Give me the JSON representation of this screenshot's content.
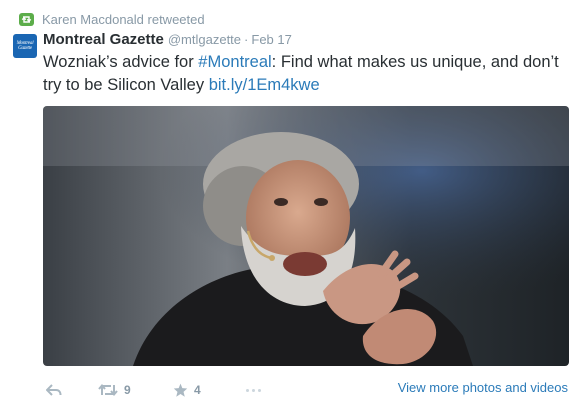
{
  "retweet": {
    "text": "Karen Macdonald retweeted",
    "icon": "retweet-icon",
    "color": "#5cad4a"
  },
  "tweet": {
    "avatar_text": "Montreal Gazette",
    "author": "Montreal Gazette",
    "handle": "@mtlgazette",
    "separator": "·",
    "time": "Feb 17",
    "text_before": "Wozniak’s advice for ",
    "hashtag": "#Montreal",
    "text_after": ": Find what makes us unique, and don’t try to be Silicon Valley ",
    "link": "bit.ly/1Em4kwe",
    "link_color": "#2b7bb9"
  },
  "media": {
    "icon": "photo-speaker-icon"
  },
  "actions": {
    "reply_icon": "reply-icon",
    "retweet_icon": "retweet-icon",
    "retweet_count": "9",
    "favorite_icon": "star-icon",
    "favorite_count": "4",
    "more_icon": "more-dots-icon",
    "view_more": "View more photos and videos"
  }
}
